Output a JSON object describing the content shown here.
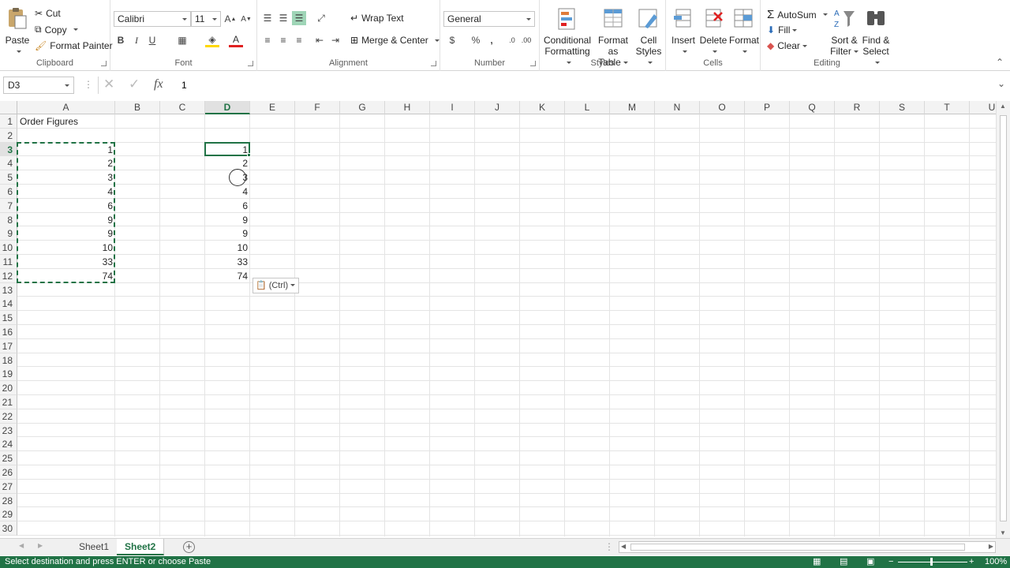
{
  "ribbon": {
    "clipboard": {
      "label": "Clipboard",
      "paste": "Paste",
      "cut": "Cut",
      "copy": "Copy",
      "format_painter": "Format Painter"
    },
    "font": {
      "label": "Font",
      "name": "Calibri",
      "size": "11"
    },
    "alignment": {
      "label": "Alignment",
      "wrap_text": "Wrap Text",
      "merge_center": "Merge & Center"
    },
    "number": {
      "label": "Number",
      "format": "General"
    },
    "styles": {
      "label": "Styles",
      "conditional_1": "Conditional",
      "conditional_2": "Formatting",
      "format_table_1": "Format as",
      "format_table_2": "Table",
      "cell_styles_1": "Cell",
      "cell_styles_2": "Styles"
    },
    "cells": {
      "label": "Cells",
      "insert": "Insert",
      "delete": "Delete",
      "format": "Format"
    },
    "editing": {
      "label": "Editing",
      "autosum": "AutoSum",
      "fill": "Fill",
      "clear": "Clear",
      "sort_1": "Sort &",
      "sort_2": "Filter",
      "find_1": "Find &",
      "find_2": "Select"
    }
  },
  "formula_bar": {
    "name_box": "D3",
    "fx": "fx",
    "value": "1"
  },
  "sheet": {
    "columns": [
      "A",
      "B",
      "C",
      "D",
      "E",
      "F",
      "G",
      "H",
      "I",
      "J",
      "K",
      "L",
      "M",
      "N",
      "O",
      "P",
      "Q",
      "R",
      "S",
      "T",
      "U"
    ],
    "selected_column": "D",
    "rows": [
      "1",
      "2",
      "3",
      "4",
      "5",
      "6",
      "7",
      "8",
      "9",
      "10",
      "11",
      "12",
      "13",
      "14",
      "15",
      "16",
      "17",
      "18",
      "19",
      "20",
      "21",
      "22",
      "23",
      "24",
      "25",
      "26",
      "27",
      "28",
      "29",
      "30"
    ],
    "selected_row": "3",
    "title_cell": "Order Figures",
    "col_a_values": [
      "1",
      "2",
      "3",
      "4",
      "6",
      "9",
      "9",
      "10",
      "33",
      "74"
    ],
    "col_d_values": [
      "1",
      "2",
      "3",
      "4",
      "6",
      "9",
      "9",
      "10",
      "33",
      "74"
    ],
    "paste_options": "(Ctrl)"
  },
  "tabs": [
    {
      "name": "Sheet1",
      "active": false
    },
    {
      "name": "Sheet2",
      "active": true
    }
  ],
  "status": {
    "message": "Select destination and press ENTER or choose Paste",
    "zoom": "100%"
  },
  "colors": {
    "accent": "#217346",
    "header_bg": "#f3f3f3"
  }
}
